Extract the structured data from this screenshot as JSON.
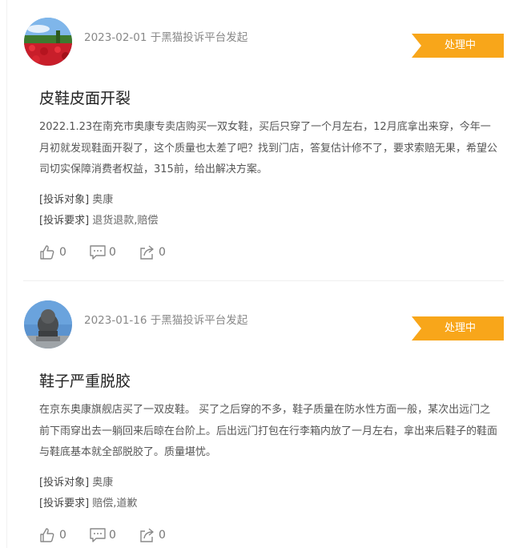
{
  "posts": [
    {
      "date_source": "2023-02-01 于黑猫投诉平台发起",
      "status": "处理中",
      "title": "皮鞋皮面开裂",
      "content": "2022.1.23在南充市奥康专卖店购买一双女鞋，买后只穿了一个月左右，12月底拿出来穿，今年一月初就发现鞋面开裂了，这个质量也太差了吧？找到门店，答复估计修不了，要求索赔无果，希望公司切实保障消费者权益，315前，给出解决方案。",
      "target_label": "[投诉对象]",
      "target_value": "奥康",
      "request_label": "[投诉要求]",
      "request_value": "退货退款,赔偿",
      "likes": "0",
      "comments": "0",
      "shares": "0"
    },
    {
      "date_source": "2023-01-16 于黑猫投诉平台发起",
      "status": "处理中",
      "title": "鞋子严重脱胶",
      "content": "在京东奥康旗舰店买了一双皮鞋。 买了之后穿的不多，鞋子质量在防水性方面一般，某次出远门之前下雨穿出去一躺回来后晾在台阶上。后出远门打包在行李箱内放了一月左右，拿出来后鞋子的鞋面与鞋底基本就全部脱胶了。质量堪忧。",
      "target_label": "[投诉对象]",
      "target_value": "奥康",
      "request_label": "[投诉要求]",
      "request_value": "赔偿,道歉",
      "likes": "0",
      "comments": "0",
      "shares": "0"
    }
  ],
  "colors": {
    "status_bg": "#f8a61a",
    "divider": "#efefef"
  },
  "icons": {
    "like": "thumbs-up-icon",
    "comment": "comment-icon",
    "share": "share-icon"
  }
}
